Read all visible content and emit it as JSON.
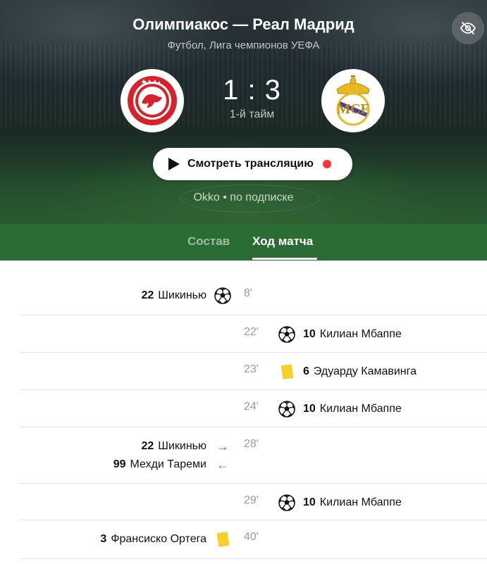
{
  "match": {
    "title": "Олимпиакос — Реал Мадрид",
    "subtitle": "Футбол, Лига чемпионов УЕФА",
    "score": "1 : 3",
    "period": "1-й тайм",
    "home_team_icon": "olympiacos-crest-icon",
    "away_team_icon": "real-madrid-crest-icon"
  },
  "watch": {
    "label": "Смотреть трансляцию",
    "provider": "Okko • по подписке",
    "live_color": "#ff3333"
  },
  "tabs": [
    {
      "label": "Состав",
      "active": false
    },
    {
      "label": "Ход матча",
      "active": true
    }
  ],
  "colors": {
    "tab_bar": "#2b6b34",
    "yellow_card": "#f5d02b",
    "sub_out": "#e6383c",
    "sub_in": "#4caf50"
  },
  "events": [
    {
      "minute": "8'",
      "side": "home",
      "lines": [
        {
          "number": "22",
          "player": "Шикинью",
          "icon": "goal-ball-icon"
        }
      ]
    },
    {
      "minute": "22'",
      "side": "away",
      "lines": [
        {
          "number": "10",
          "player": "Килиан Мбаппе",
          "icon": "goal-ball-icon"
        }
      ]
    },
    {
      "minute": "23'",
      "side": "away",
      "lines": [
        {
          "number": "6",
          "player": "Эдуарду Камавинга",
          "icon": "yellow-card-icon"
        }
      ]
    },
    {
      "minute": "24'",
      "side": "away",
      "lines": [
        {
          "number": "10",
          "player": "Килиан Мбаппе",
          "icon": "goal-ball-icon"
        }
      ]
    },
    {
      "minute": "28'",
      "side": "home",
      "lines": [
        {
          "number": "22",
          "player": "Шикинью",
          "icon": "substitution-out-arrow-icon"
        },
        {
          "number": "99",
          "player": "Мехди Тареми",
          "icon": "substitution-in-arrow-icon"
        }
      ]
    },
    {
      "minute": "29'",
      "side": "away",
      "lines": [
        {
          "number": "10",
          "player": "Килиан Мбаппе",
          "icon": "goal-ball-icon"
        }
      ]
    },
    {
      "minute": "40'",
      "side": "home",
      "lines": [
        {
          "number": "3",
          "player": "Франсиско Ортега",
          "icon": "yellow-card-icon"
        }
      ]
    }
  ]
}
